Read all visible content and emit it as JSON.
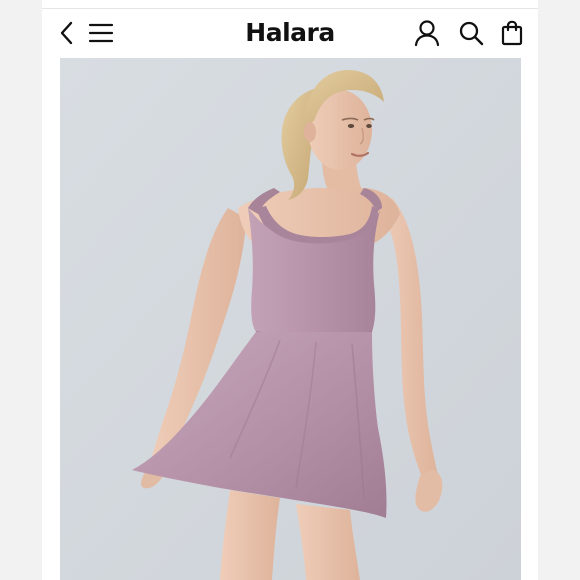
{
  "header": {
    "logo_text": "Halara",
    "icons": {
      "back": "chevron-left-icon",
      "menu": "hamburger-menu-icon",
      "account": "user-icon",
      "search": "search-icon",
      "bag": "shopping-bag-icon"
    }
  },
  "product_image": {
    "subject": "product-photo",
    "colors": {
      "background": "#d3d8dd",
      "dress": "#b895ab",
      "skin": "#e8c2ab",
      "hair": "#d8be8e"
    }
  }
}
